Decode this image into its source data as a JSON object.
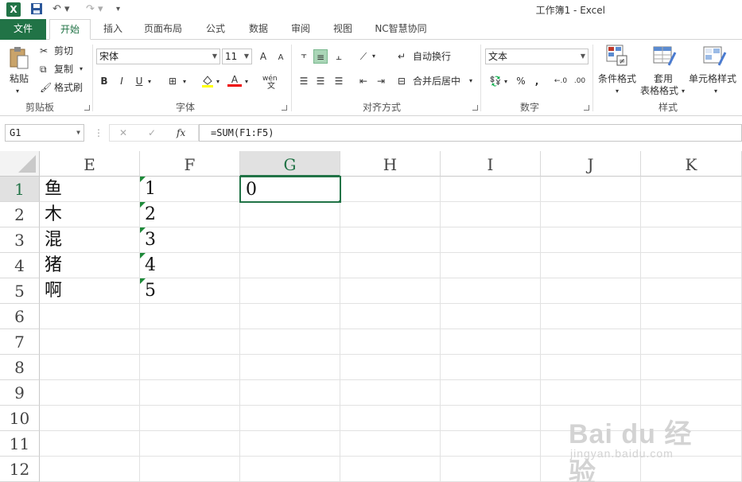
{
  "window": {
    "title": "工作簿1 - Excel",
    "app_icon": "X"
  },
  "ribbon_tabs": [
    "文件",
    "开始",
    "插入",
    "页面布局",
    "公式",
    "数据",
    "审阅",
    "视图",
    "NC智慧协同"
  ],
  "clipboard": {
    "paste": "粘贴",
    "cut": "剪切",
    "copy": "复制",
    "format_painter": "格式刷",
    "label": "剪贴板"
  },
  "font": {
    "name": "宋体",
    "size": "11",
    "bold": "B",
    "italic": "I",
    "underline": "U",
    "grow": "A",
    "shrink": "A",
    "font_color": "A",
    "phonetic": "wén",
    "label": "字体"
  },
  "alignment": {
    "wrap": "自动换行",
    "merge": "合并后居中",
    "label": "对齐方式"
  },
  "number": {
    "format": "文本",
    "percent": "%",
    "comma": ",",
    "label": "数字"
  },
  "styles": {
    "conditional": "条件格式",
    "table1": "套用",
    "table2": "表格格式",
    "cell_styles": "单元格样式",
    "label": "样式"
  },
  "formula_bar": {
    "name_box": "G1",
    "cancel": "✕",
    "enter": "✓",
    "fx": "fx",
    "formula": "=SUM(F1:F5)"
  },
  "columns": [
    "E",
    "F",
    "G",
    "H",
    "I",
    "J",
    "K"
  ],
  "selected_column": "G",
  "rows": [
    "1",
    "2",
    "3",
    "4",
    "5",
    "6",
    "7",
    "8",
    "9",
    "10",
    "11",
    "12"
  ],
  "cells": {
    "E": [
      "鱼",
      "木",
      "混",
      "猪",
      "啊"
    ],
    "F": [
      "1",
      "2",
      "3",
      "4",
      "5"
    ],
    "G1": "0"
  },
  "watermark": {
    "main": "Bai du 经验",
    "sub": "jingyan.baidu.com"
  }
}
